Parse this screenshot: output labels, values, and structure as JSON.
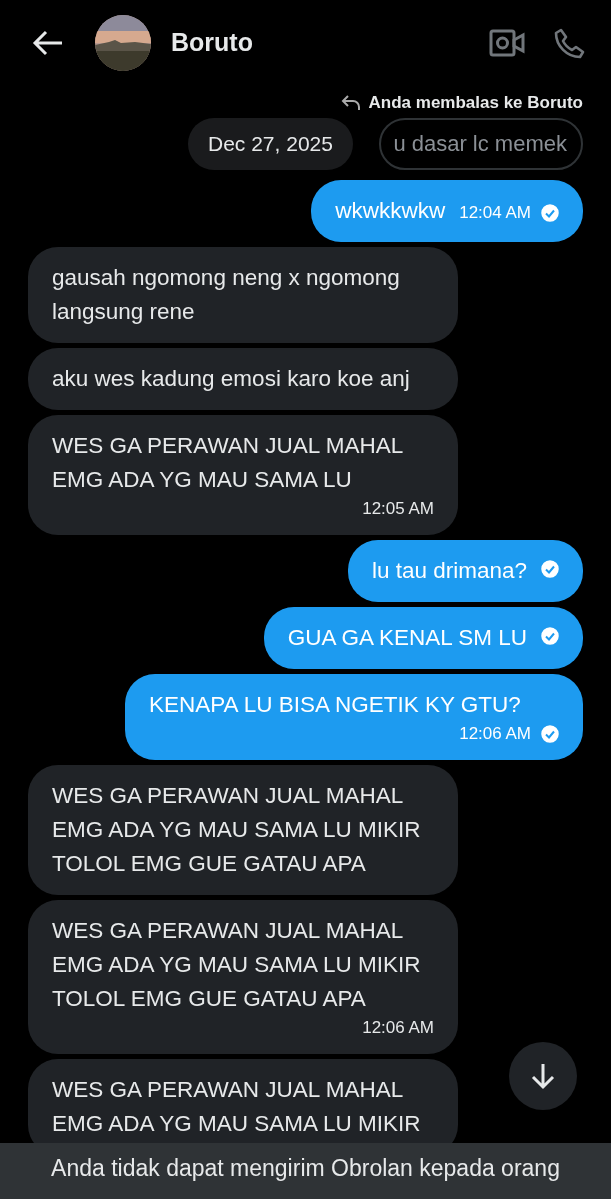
{
  "header": {
    "name": "Boruto"
  },
  "reply": {
    "label": "Anda membalas ke Boruto",
    "quoted": "u dasar lc memek"
  },
  "date_pill": "Dec 27, 2025",
  "messages": [
    {
      "kind": "out",
      "text": "wkwkkwkw",
      "time": "12:04 AM",
      "read": true
    },
    {
      "kind": "in",
      "text": "gausah ngomong neng x ngomong langsung rene"
    },
    {
      "kind": "in",
      "text": "aku wes kadung emosi karo koe anj"
    },
    {
      "kind": "in",
      "text": "WES GA PERAWAN JUAL MAHAL EMG ADA YG MAU SAMA LU",
      "time": "12:05 AM"
    },
    {
      "kind": "out",
      "text": "lu tau drimana?",
      "read": true
    },
    {
      "kind": "out",
      "text": "GUA GA KENAL SM LU",
      "read": true
    },
    {
      "kind": "out",
      "text": "KENAPA LU BISA NGETIK KY GTU?",
      "time": "12:06 AM",
      "read": true
    },
    {
      "kind": "in",
      "text": "WES GA PERAWAN JUAL MAHAL EMG ADA YG MAU SAMA LU MIKIR TOLOL EMG GUE GATAU APA"
    },
    {
      "kind": "in",
      "text": "WES GA PERAWAN JUAL MAHAL EMG ADA YG MAU SAMA LU MIKIR TOLOL EMG GUE GATAU APA",
      "time": "12:06 AM"
    },
    {
      "kind": "in",
      "text": "WES GA PERAWAN JUAL MAHAL EMG ADA YG MAU SAMA LU MIKIR"
    }
  ],
  "notice": "Anda tidak dapat mengirim Obrolan kepada orang"
}
